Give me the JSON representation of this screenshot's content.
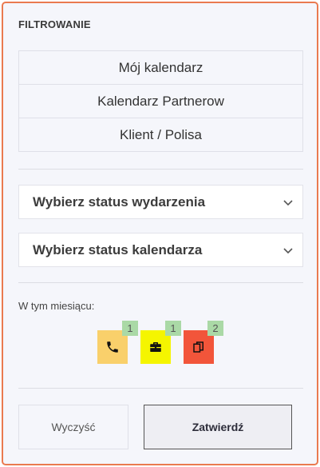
{
  "filter": {
    "title": "FILTROWANIE",
    "calendars": [
      {
        "label": "Mój kalendarz"
      },
      {
        "label": "Kalendarz Partnerow"
      },
      {
        "label": "Klient / Polisa"
      }
    ],
    "event_status_select": {
      "label": "Wybierz status wydarzenia",
      "icon": "chevron-down-icon"
    },
    "calendar_status_select": {
      "label": "Wybierz status kalendarza",
      "icon": "chevron-down-icon"
    }
  },
  "month_summary": {
    "label": "W tym miesiącu:",
    "items": [
      {
        "icon": "phone-icon",
        "count": "1",
        "color": "#f9d06b"
      },
      {
        "icon": "briefcase-icon",
        "count": "1",
        "color": "#f5f500"
      },
      {
        "icon": "copy-icon",
        "count": "2",
        "color": "#f2553a"
      }
    ]
  },
  "actions": {
    "clear_label": "Wyczyść",
    "confirm_label": "Zatwierdź"
  },
  "colors": {
    "border_accent": "#ea7a4f",
    "badge_bg": "#aad9a6"
  }
}
